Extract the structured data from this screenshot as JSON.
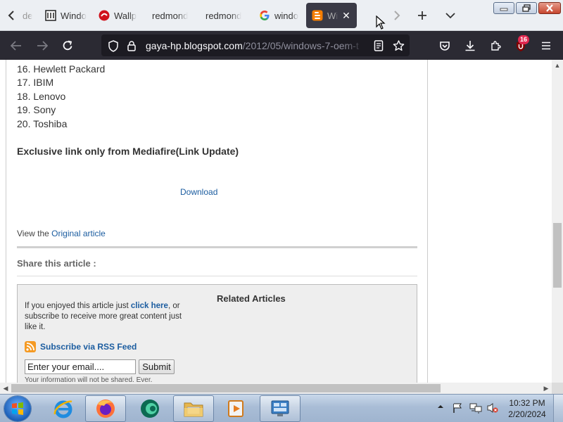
{
  "browser": {
    "tabs": [
      {
        "label": "de"
      },
      {
        "label": "Windo"
      },
      {
        "label": "Wallp"
      },
      {
        "label": "redmond"
      },
      {
        "label": "redmond"
      },
      {
        "label": "windo"
      },
      {
        "label": "Wi",
        "active": true
      }
    ],
    "url_host": "gaya-hp.blogspot.com",
    "url_path": "/2012/05/windows-7-oem-t",
    "extensions_badge": "16"
  },
  "article": {
    "list": [
      "16. Hewlett Packard",
      "17. IBIM",
      "18. Lenovo",
      "19. Sony",
      "20. Toshiba"
    ],
    "heading": "Exclusive link only from Mediafire(Link Update)",
    "download_link": "Download",
    "view_prefix": "View the ",
    "view_link": "Original article",
    "share_title": "Share this article :",
    "related": {
      "title": "Related Articles",
      "subscribe_prefix": "If you enjoyed this article just ",
      "subscribe_link": "click here",
      "subscribe_suffix": ", or subscribe to receive more great content just like it.",
      "rss_label": "Subscribe via RSS Feed",
      "email_value": "Enter your email....",
      "submit_label": "Submit",
      "privacy_note": "Your information will not be shared. Ever."
    }
  },
  "taskbar": {
    "time": "10:32 PM",
    "date": "2/20/2024"
  }
}
